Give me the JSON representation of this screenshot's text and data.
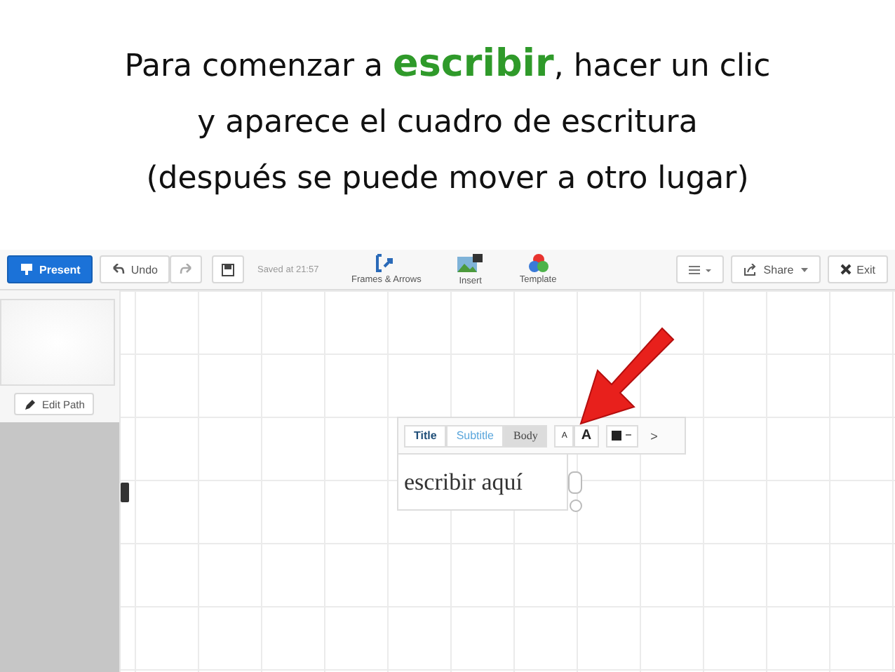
{
  "caption": {
    "lines": [
      {
        "parts": [
          {
            "text": "Para comenzar a ",
            "kind": "plain"
          },
          {
            "text": "escribir",
            "kind": "highlight"
          },
          {
            "text": ", hacer un clic",
            "kind": "plain"
          }
        ]
      },
      {
        "parts": [
          {
            "text": "y aparece el cuadro de escritura",
            "kind": "plain"
          }
        ]
      },
      {
        "parts": [
          {
            "text": "(después se puede mover a otro lugar)",
            "kind": "plain"
          }
        ]
      }
    ]
  },
  "toolbar": {
    "present": "Present",
    "undo": "Undo",
    "saved": "Saved at 21:57",
    "tools": [
      {
        "label": "Frames & Arrows",
        "kind": "frames"
      },
      {
        "label": "Insert",
        "kind": "insert"
      },
      {
        "label": "Template",
        "kind": "template"
      }
    ],
    "share": "Share",
    "exit": "Exit"
  },
  "sidebar": {
    "edit_path": "Edit Path"
  },
  "editor": {
    "styles": [
      {
        "label": "Title",
        "selected": false
      },
      {
        "label": "Subtitle",
        "selected": false
      },
      {
        "label": "Body",
        "selected": true
      }
    ],
    "size_small": "A",
    "size_large": "A",
    "more": ">",
    "text": "escribir aquí"
  }
}
